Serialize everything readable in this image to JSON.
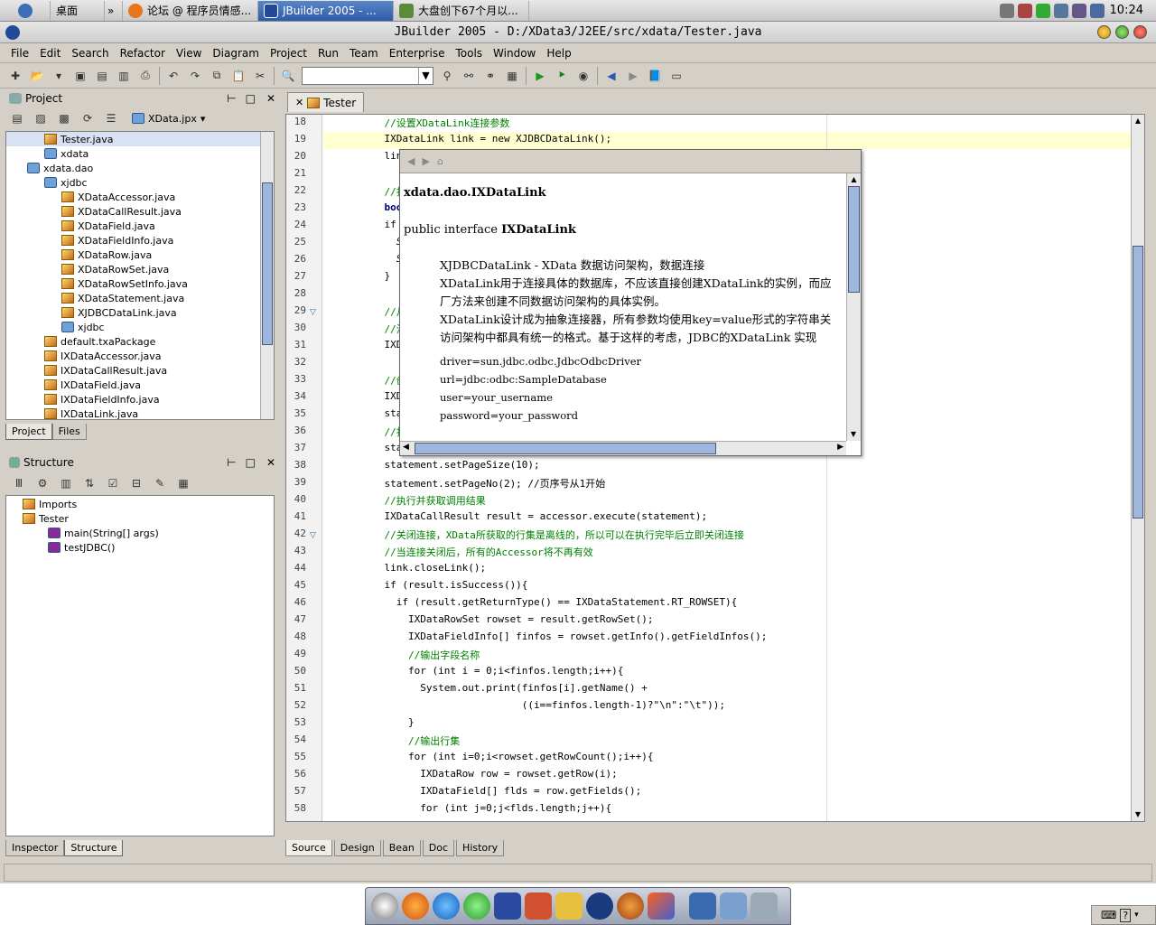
{
  "os": {
    "tasks": [
      "桌面",
      "论坛 @ 程序员情感...",
      "JBuilder 2005 - ...",
      "大盘创下67个月以..."
    ],
    "clock": "10:24"
  },
  "window": {
    "title": "JBuilder 2005 - D:/XData3/J2EE/src/xdata/Tester.java"
  },
  "menu": [
    "File",
    "Edit",
    "Search",
    "Refactor",
    "View",
    "Diagram",
    "Project",
    "Run",
    "Team",
    "Enterprise",
    "Tools",
    "Window",
    "Help"
  ],
  "project_panel": {
    "title": "Project",
    "selector": "XData.jpx",
    "items": [
      {
        "label": "Tester.java",
        "indent": 2,
        "icon": "file"
      },
      {
        "label": "xdata",
        "indent": 2,
        "icon": "pkg"
      },
      {
        "label": "xdata.dao",
        "indent": 1,
        "icon": "pkg"
      },
      {
        "label": "xjdbc",
        "indent": 2,
        "icon": "pkg"
      },
      {
        "label": "XDataAccessor.java",
        "indent": 3,
        "icon": "file"
      },
      {
        "label": "XDataCallResult.java",
        "indent": 3,
        "icon": "file"
      },
      {
        "label": "XDataField.java",
        "indent": 3,
        "icon": "file"
      },
      {
        "label": "XDataFieldInfo.java",
        "indent": 3,
        "icon": "file"
      },
      {
        "label": "XDataRow.java",
        "indent": 3,
        "icon": "file"
      },
      {
        "label": "XDataRowSet.java",
        "indent": 3,
        "icon": "file"
      },
      {
        "label": "XDataRowSetInfo.java",
        "indent": 3,
        "icon": "file"
      },
      {
        "label": "XDataStatement.java",
        "indent": 3,
        "icon": "file"
      },
      {
        "label": "XJDBCDataLink.java",
        "indent": 3,
        "icon": "file"
      },
      {
        "label": "xjdbc",
        "indent": 3,
        "icon": "pkg"
      },
      {
        "label": "default.txaPackage",
        "indent": 2,
        "icon": "file"
      },
      {
        "label": "IXDataAccessor.java",
        "indent": 2,
        "icon": "file"
      },
      {
        "label": "IXDataCallResult.java",
        "indent": 2,
        "icon": "file"
      },
      {
        "label": "IXDataField.java",
        "indent": 2,
        "icon": "file"
      },
      {
        "label": "IXDataFieldInfo.java",
        "indent": 2,
        "icon": "file"
      },
      {
        "label": "IXDataLink.java",
        "indent": 2,
        "icon": "file"
      }
    ],
    "tabs": [
      "Project",
      "Files"
    ]
  },
  "structure_panel": {
    "title": "Structure",
    "items": [
      {
        "label": "Imports",
        "indent": 1
      },
      {
        "label": "Tester",
        "indent": 1
      },
      {
        "label": "main(String[] args)",
        "indent": 3
      },
      {
        "label": "testJDBC()",
        "indent": 3
      }
    ],
    "tabs": [
      "Inspector",
      "Structure"
    ]
  },
  "editor": {
    "tab": "Tester",
    "lines": [
      {
        "n": "18",
        "t": "    //设置XDataLink连接参数",
        "c": "cm"
      },
      {
        "n": "19",
        "t": "    IXDataLink link = new XJDBCDataLink();",
        "c": ""
      },
      {
        "n": "20",
        "t": "    link.s",
        "c": ""
      },
      {
        "n": "21",
        "t": "",
        "c": ""
      },
      {
        "n": "22",
        "t": "    //打开连",
        "c": "cm"
      },
      {
        "n": "23",
        "t": "    boolea",
        "c": "kw"
      },
      {
        "n": "24",
        "t": "    if (!l",
        "c": ""
      },
      {
        "n": "25",
        "t": "      Syst",
        "c": "it"
      },
      {
        "n": "26",
        "t": "      Syst",
        "c": "it"
      },
      {
        "n": "27",
        "t": "    }",
        "c": ""
      },
      {
        "n": "28",
        "t": "",
        "c": ""
      },
      {
        "n": "29",
        "t": "    //从XD",
        "c": "cm"
      },
      {
        "n": "30",
        "t": "    //注意",
        "c": "cm"
      },
      {
        "n": "31",
        "t": "    IXData",
        "c": ""
      },
      {
        "n": "32",
        "t": "",
        "c": ""
      },
      {
        "n": "33",
        "t": "    //创建X",
        "c": "cm"
      },
      {
        "n": "34",
        "t": "    IXData",
        "c": ""
      },
      {
        "n": "35",
        "t": "    statem",
        "c": ""
      },
      {
        "n": "36",
        "t": "    //打开外",
        "c": "cm"
      },
      {
        "n": "37",
        "t": "    statem",
        "c": ""
      },
      {
        "n": "38",
        "t": "    statement.setPageSize(10);",
        "c": ""
      },
      {
        "n": "39",
        "t": "    statement.setPageNo(2); //页序号从1开始",
        "c": ""
      },
      {
        "n": "40",
        "t": "    //执行并获取调用结果",
        "c": "cm"
      },
      {
        "n": "41",
        "t": "    IXDataCallResult result = accessor.execute(statement);",
        "c": ""
      },
      {
        "n": "42",
        "t": "    //关闭连接，XData所获取的行集是离线的，所以可以在执行完毕后立即关闭连接",
        "c": "cm"
      },
      {
        "n": "43",
        "t": "    //当连接关闭后，所有的Accessor将不再有效",
        "c": "cm"
      },
      {
        "n": "44",
        "t": "    link.closeLink();",
        "c": ""
      },
      {
        "n": "45",
        "t": "    if (result.isSuccess()){",
        "c": ""
      },
      {
        "n": "46",
        "t": "      if (result.getReturnType() == IXDataStatement.RT_ROWSET){",
        "c": ""
      },
      {
        "n": "47",
        "t": "        IXDataRowSet rowset = result.getRowSet();",
        "c": ""
      },
      {
        "n": "48",
        "t": "        IXDataFieldInfo[] finfos = rowset.getInfo().getFieldInfos();",
        "c": ""
      },
      {
        "n": "49",
        "t": "        //输出字段名称",
        "c": "cm"
      },
      {
        "n": "50",
        "t": "        for (int i = 0;i<finfos.length;i++){",
        "c": ""
      },
      {
        "n": "51",
        "t": "          System.out.print(finfos[i].getName() +",
        "c": ""
      },
      {
        "n": "52",
        "t": "                           ((i==finfos.length-1)?\"\\n\":\"\\t\"));",
        "c": ""
      },
      {
        "n": "53",
        "t": "        }",
        "c": ""
      },
      {
        "n": "54",
        "t": "        //输出行集",
        "c": "cm"
      },
      {
        "n": "55",
        "t": "        for (int i=0;i<rowset.getRowCount();i++){",
        "c": ""
      },
      {
        "n": "56",
        "t": "          IXDataRow row = rowset.getRow(i);",
        "c": ""
      },
      {
        "n": "57",
        "t": "          IXDataField[] flds = row.getFields();",
        "c": ""
      },
      {
        "n": "58",
        "t": "          for (int j=0;j<flds.length;j++){",
        "c": ""
      }
    ],
    "bottom_tabs": [
      "Source",
      "Design",
      "Bean",
      "Doc",
      "History"
    ]
  },
  "doc_popup": {
    "heading": "xdata.dao.IXDataLink",
    "signature_prefix": "public interface ",
    "signature_name": "IXDataLink",
    "paragraphs": [
      "XJDBCDataLink - XData 数据访问架构，数据连接",
      "XDataLink用于连接具体的数据库，不应该直接创建XDataLink的实例，而应",
      "厂方法来创建不同数据访问架构的具体实例。",
      "XDataLink设计成为抽象连接器，所有参数均使用key=value形式的字符串关",
      "访问架构中都具有统一的格式。基于这样的考虑，JDBC的XDataLink 实现"
    ],
    "code": [
      "driver=sun.jdbc.odbc.JdbcOdbcDriver",
      "url=jdbc:odbc:SampleDatabase",
      "user=your_username",
      "password=your_password"
    ]
  }
}
